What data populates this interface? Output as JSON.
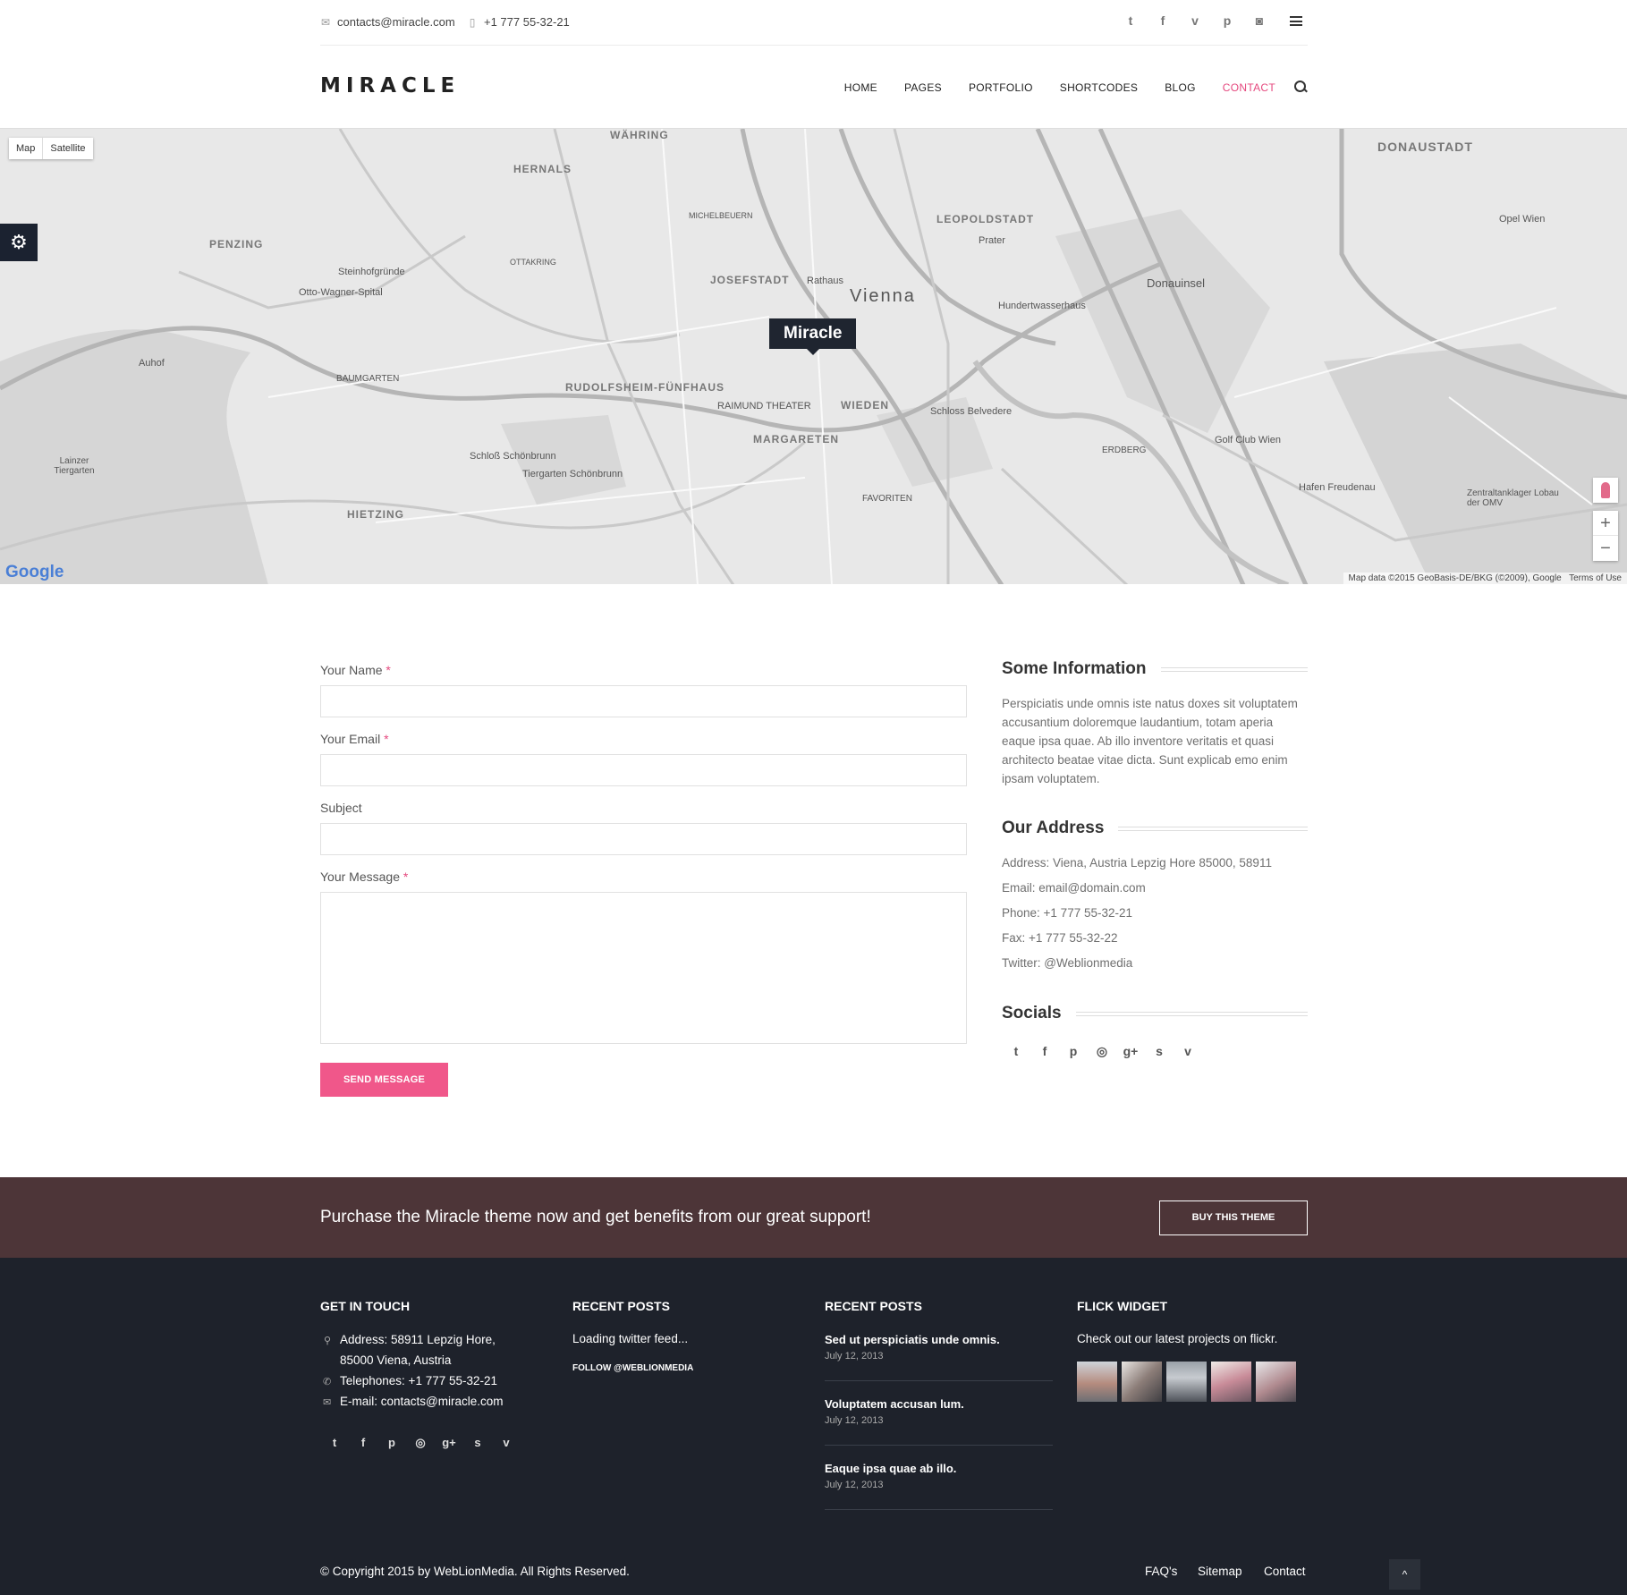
{
  "topbar": {
    "email": "contacts@miracle.com",
    "phone": "+1 777 55-32-21",
    "socials": [
      "twitter-icon",
      "facebook-icon",
      "vimeo-icon",
      "pinterest-icon",
      "instagram-icon"
    ]
  },
  "header": {
    "logo": "MIRACLE",
    "nav": [
      "HOME",
      "PAGES",
      "PORTFOLIO",
      "SHORTCODES",
      "BLOG",
      "CONTACT"
    ],
    "active": "CONTACT"
  },
  "map": {
    "type_map": "Map",
    "type_satellite": "Satellite",
    "marker": "Miracle",
    "google": "Google",
    "attribution": "Map data ©2015 GeoBasis-DE/BKG (©2009), Google",
    "terms": "Terms of Use",
    "labels": [
      "WÄHRING",
      "HERNALS",
      "PENZING",
      "LEOPOLDSTADT",
      "DONAUSTADT",
      "JOSEFSTADT",
      "Vienna",
      "Rathaus",
      "Prater",
      "Donauinsel",
      "Hundertwasserhaus",
      "RUDOLFSHEIM-FÜNFHAUS",
      "BAUMGARTEN",
      "Auhof",
      "Steinhofgründe",
      "Otto-Wagner-Spital",
      "RAIMUND THEATER",
      "WIEDEN",
      "Schloss Belvedere",
      "MARGARETEN",
      "Golf Club Wien",
      "Schloß Schönbrunn",
      "Tiergarten Schönbrunn",
      "Hafen Freudenau",
      "Lainzer Tiergarten",
      "HIETZING",
      "Opel Wien",
      "ERDBERG",
      "FAVORITEN",
      "Zentraltanklager Lobau der OMV",
      "OTTAKRING",
      "MICHELBEUERN"
    ]
  },
  "form": {
    "name_label": "Your Name",
    "email_label": "Your Email",
    "subject_label": "Subject",
    "message_label": "Your Message",
    "required_mark": "*",
    "send_label": "SEND MESSAGE"
  },
  "info": {
    "title": "Some Information",
    "text": "Perspiciatis unde omnis iste natus doxes sit voluptatem accusantium doloremque laudantium, totam aperia eaque ipsa quae. Ab illo inventore veritatis et quasi architecto beatae vitae dicta. Sunt explicab emo enim ipsam voluptatem."
  },
  "address": {
    "title": "Our Address",
    "lines": [
      "Address: Viena, Austria Lepzig Hore 85000, 58911",
      "Email: email@domain.com",
      "Phone: +1 777 55-32-21",
      "Fax: +1 777 55-32-22",
      "Twitter: @Weblionmedia"
    ]
  },
  "socials": {
    "title": "Socials",
    "icons": [
      "twitter-icon",
      "facebook-icon",
      "pinterest-icon",
      "dribbble-icon",
      "google-plus-icon",
      "skype-icon",
      "vimeo-icon"
    ]
  },
  "band": {
    "text": "Purchase the Miracle theme now and get benefits from our great support!",
    "button": "BUY THIS THEME"
  },
  "footer": {
    "touch_title": "GET IN TOUCH",
    "address1": "Address: 58911 Lepzig Hore,",
    "address2": "85000 Viena, Austria",
    "telephone": "Telephones: +1 777 55-32-21",
    "email": "E-mail: contacts@miracle.com",
    "twitter_title": "RECENT POSTS",
    "twitter_loading": "Loading twitter feed...",
    "follow": "FOLLOW @WEBLIONMEDIA",
    "posts_title": "RECENT POSTS",
    "posts": [
      {
        "title": "Sed ut perspiciatis unde omnis.",
        "date": "July 12, 2013"
      },
      {
        "title": "Voluptatem accusan lum.",
        "date": "July 12, 2013"
      },
      {
        "title": "Eaque ipsa quae ab illo.",
        "date": "July 12, 2013"
      }
    ],
    "flickr_title": "FLICK WIDGET",
    "flickr_text": "Check out our latest projects on flickr.",
    "copyright": "© Copyright 2015 by WebLionMedia. All Rights Reserved.",
    "links": [
      "FAQ's",
      "Sitemap",
      "Contact"
    ]
  },
  "colors": {
    "accent": "#e5487e",
    "band": "#4d3538",
    "footer": "#1e222b",
    "marker": "#1f2530"
  }
}
